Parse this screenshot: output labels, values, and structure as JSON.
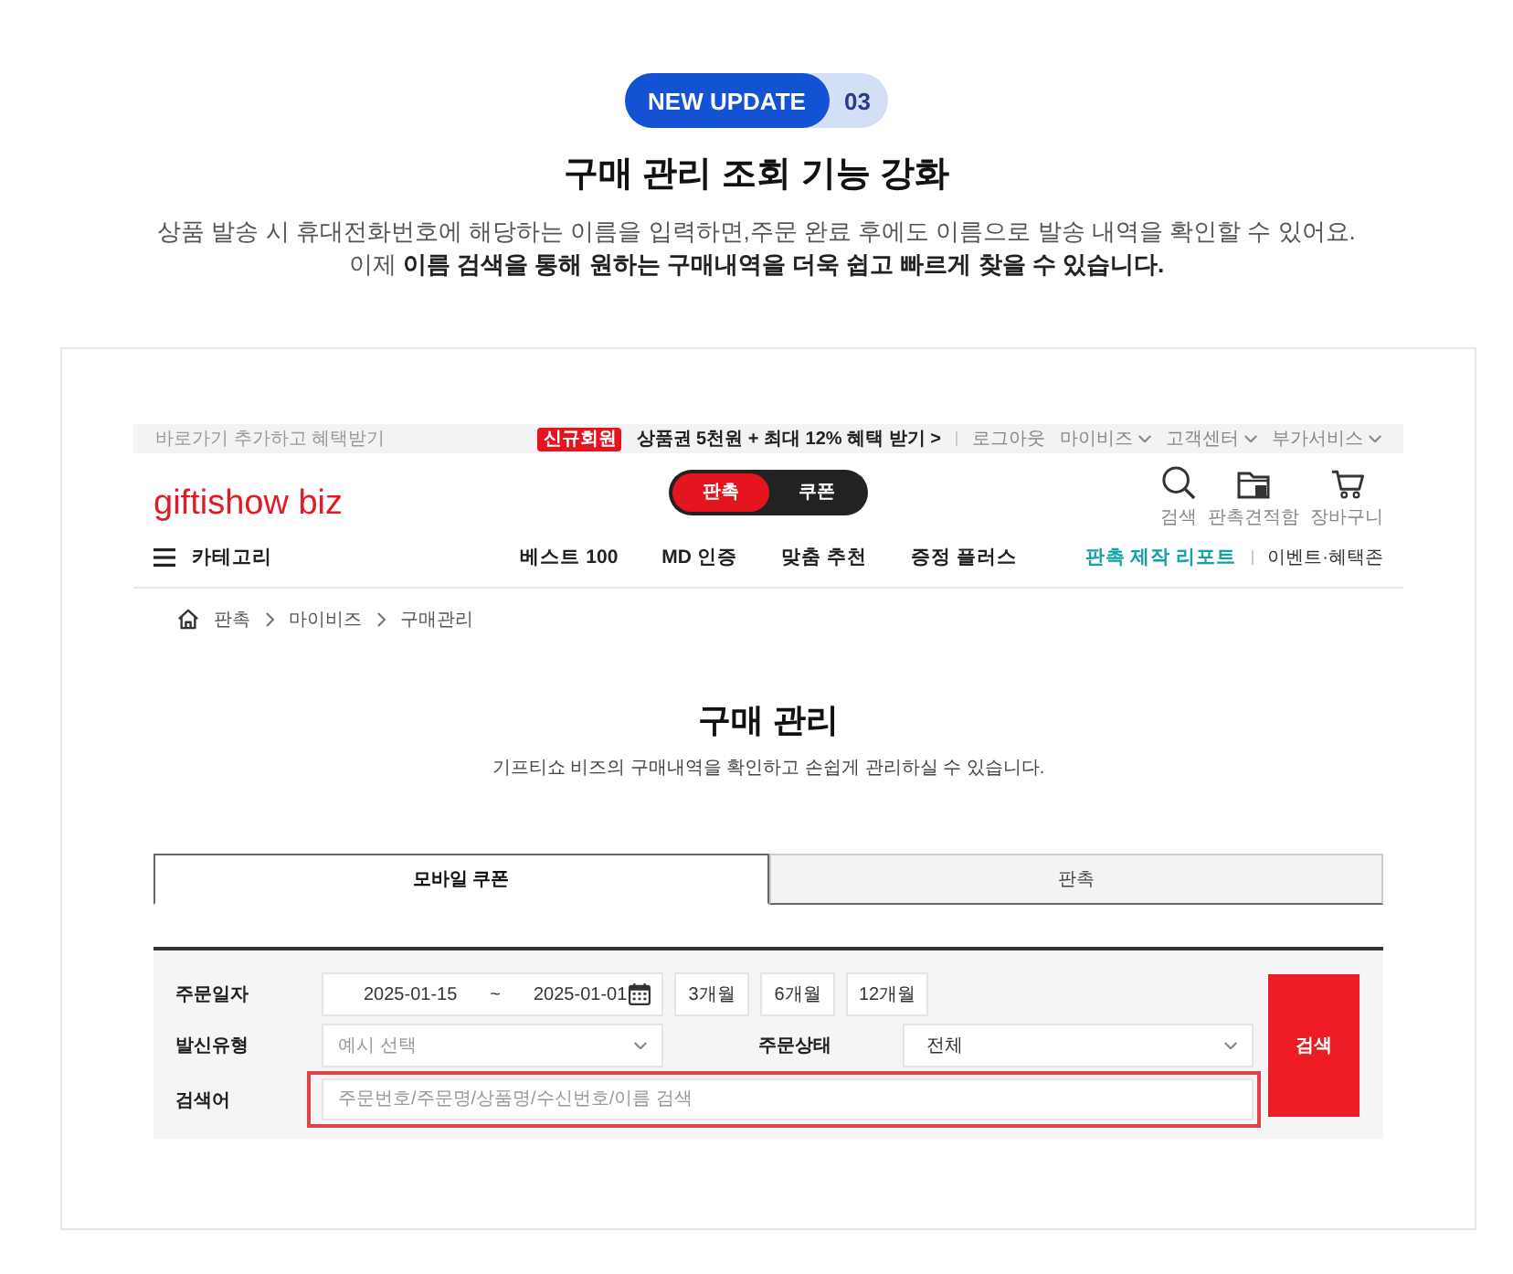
{
  "badge": {
    "label": "NEW UPDATE",
    "number": "03"
  },
  "headline": "구매 관리 조회 기능 강화",
  "description": [
    "상품 발송 시 휴대전화번호에 해당하는 이름을 입력하면,주문 완료 후에도 이름으로 발송 내역을 확인할 수 있어요.",
    "이제 **이름 검색을 통해 원하는 구매내역을 더욱 쉽고 빠르게 찾을 수 있습니다.**"
  ],
  "screenshot": {
    "top_bar": {
      "shortcut_hint": "바로가기 추가하고 혜택받기",
      "promo_tag": "신규회원",
      "promo_text": "상품권 5천원 + 최대 12% 혜택 받기 >",
      "links": [
        {
          "label": "로그아웃",
          "dropdown": false
        },
        {
          "label": "마이비즈",
          "dropdown": true
        },
        {
          "label": "고객센터",
          "dropdown": true
        },
        {
          "label": "부가서비스",
          "dropdown": true
        }
      ]
    },
    "header": {
      "logo": "giftishow biz",
      "mode_toggle": [
        {
          "label": "판촉",
          "selected": true
        },
        {
          "label": "쿠폰",
          "selected": false
        }
      ],
      "shortcuts": [
        {
          "kind": "search",
          "label": "검색"
        },
        {
          "kind": "folder",
          "label": "판촉견적함"
        },
        {
          "kind": "cart",
          "label": "장바구니"
        }
      ]
    },
    "nav": {
      "category": "카테고리",
      "items": [
        "베스트 100",
        "MD 인증",
        "맞춤 추천",
        "증정 플러스"
      ],
      "report_link": "판촉 제작 리포트",
      "event_link": "이벤트·혜택존"
    },
    "breadcrumb": [
      "판촉",
      "마이비즈",
      "구매관리"
    ],
    "page_title": "구매 관리",
    "page_subtitle": "기프티쇼 비즈의 구매내역을 확인하고 손쉽게 관리하실 수 있습니다.",
    "tabs": [
      {
        "label": "모바일 쿠폰",
        "selected": true
      },
      {
        "label": "판촉",
        "selected": false
      }
    ],
    "filters": {
      "order_date": {
        "label": "주문일자",
        "start": "2025-01-15",
        "separator": "~",
        "end": "2025-01-01"
      },
      "period_buttons": [
        "3개월",
        "6개월",
        "12개월"
      ],
      "send_type": {
        "label": "발신유형",
        "placeholder": "예시 선택"
      },
      "order_status": {
        "label": "주문상태",
        "value": "전체"
      },
      "keyword": {
        "label": "검색어",
        "placeholder": "주문번호/주문명/상품명/수신번호/이름 검색",
        "highlighted": true
      },
      "search_button": "검색"
    }
  }
}
